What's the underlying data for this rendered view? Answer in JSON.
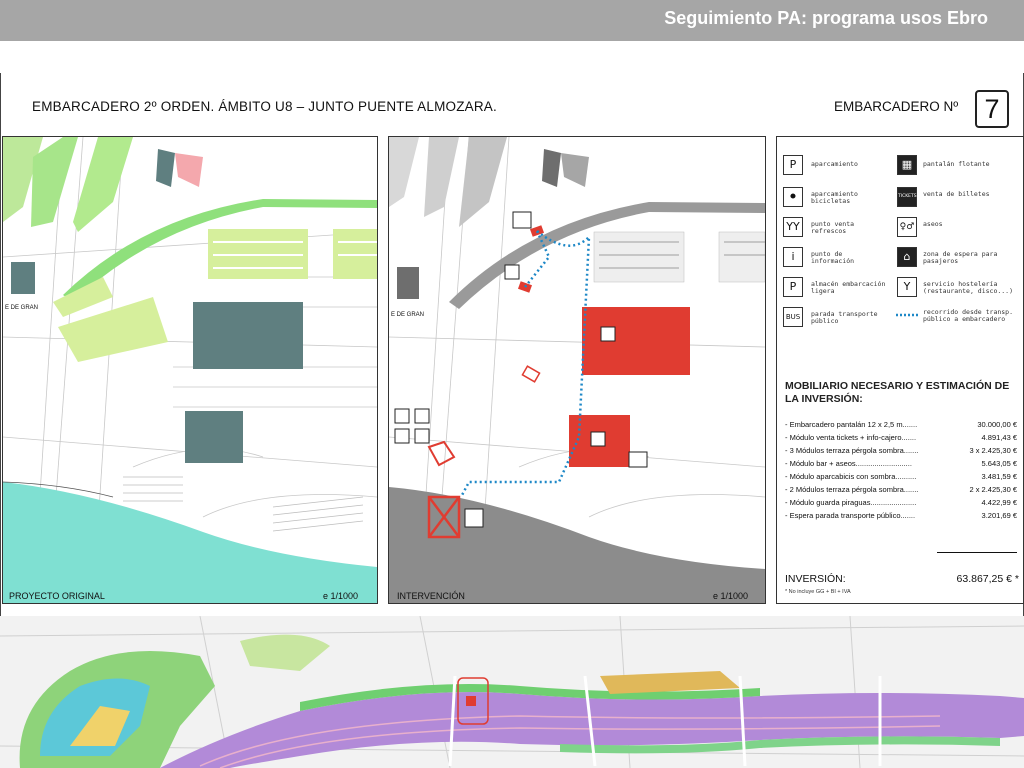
{
  "header": {
    "title": "Seguimiento PA: programa usos Ebro"
  },
  "sheet": {
    "heading_left": "EMBARCADERO 2º ORDEN.   ÁMBITO U8 – JUNTO PUENTE ALMOZARA.",
    "heading_right": "EMBARCADERO Nº",
    "number": "7",
    "left_panel": {
      "caption": "PROYECTO ORIGINAL",
      "scale": "e  1/1000",
      "street_label": "E DE GRAN"
    },
    "mid_panel": {
      "caption": "INTERVENCIÓN",
      "scale": "e  1/1000",
      "street_label": "E DE GRAN"
    }
  },
  "legend": {
    "items": [
      {
        "icon": "P",
        "icon_name": "parking-icon",
        "text": "aparcamiento"
      },
      {
        "icon": "⚫",
        "icon_name": "bicycle-icon",
        "text": "aparcamiento bicicletas"
      },
      {
        "icon": "YY",
        "icon_name": "drinks-icon",
        "text": "punto venta refrescos"
      },
      {
        "icon": "i",
        "icon_name": "info-icon",
        "text": "punto de información"
      },
      {
        "icon": "P",
        "icon_name": "boat-storage-icon",
        "text": "almacén embarcación ligera"
      },
      {
        "icon": "BUS",
        "icon_name": "bus-icon",
        "text": "parada transporte público"
      },
      {
        "icon": "▦",
        "icon_name": "floating-pontoon-icon",
        "text": "pantalán flotante"
      },
      {
        "icon": "TICKETS",
        "icon_name": "ticket-icon",
        "text": "venta de billetes"
      },
      {
        "icon": "♀♂",
        "icon_name": "toilets-icon",
        "text": "aseos"
      },
      {
        "icon": "⌂",
        "icon_name": "waiting-area-icon",
        "text": "zona de espera para pasajeros"
      },
      {
        "icon": "Y",
        "icon_name": "hospitality-icon",
        "text": "servicio hostelería (restaurante, disco...)"
      },
      {
        "icon": "",
        "icon_name": "route-line-icon",
        "text": "recorrido desde transp. público a embarcadero"
      }
    ],
    "route_color": "#1e88c7"
  },
  "mobiliario": {
    "title": "MOBILIARIO NECESARIO Y ESTIMACIÓN DE LA INVERSIÓN:",
    "rows": [
      {
        "label": "- Embarcadero pantalán  12 x 2,5 m.......",
        "value": "30.000,00 €"
      },
      {
        "label": "- Módulo venta tickets + info-cajero.......",
        "value": "4.891,43 €"
      },
      {
        "label": "- 3 Módulos terraza pérgola sombra.......",
        "value": "3 x 2.425,30 €"
      },
      {
        "label": "- Módulo bar + aseos...........................",
        "value": "5.643,05 €"
      },
      {
        "label": "- Módulo aparcabicis con sombra..........",
        "value": "3.481,59 €"
      },
      {
        "label": "- 2 Módulos terraza pérgola sombra.......",
        "value": "2 x 2.425,30 €"
      },
      {
        "label": "- Módulo guarda piraguas......................",
        "value": "4.422,99 €"
      },
      {
        "label": "- Espera parada transporte público.......",
        "value": "3.201,69 €"
      }
    ],
    "total_label": "INVERSIÓN:",
    "total_value": "63.867,25 € *",
    "footnote": "* No incluye GG + BI + IVA"
  },
  "colors": {
    "banner": "#a6a6a6",
    "water": "#7fe0d2",
    "green": "#8be07a",
    "light_green": "#d9f0a3",
    "slate": "#5f7f80",
    "red": "#e03c31",
    "grey_dark": "#8c8c8c",
    "river_purple": "#b28ad8",
    "route_blue": "#1e88c7"
  }
}
